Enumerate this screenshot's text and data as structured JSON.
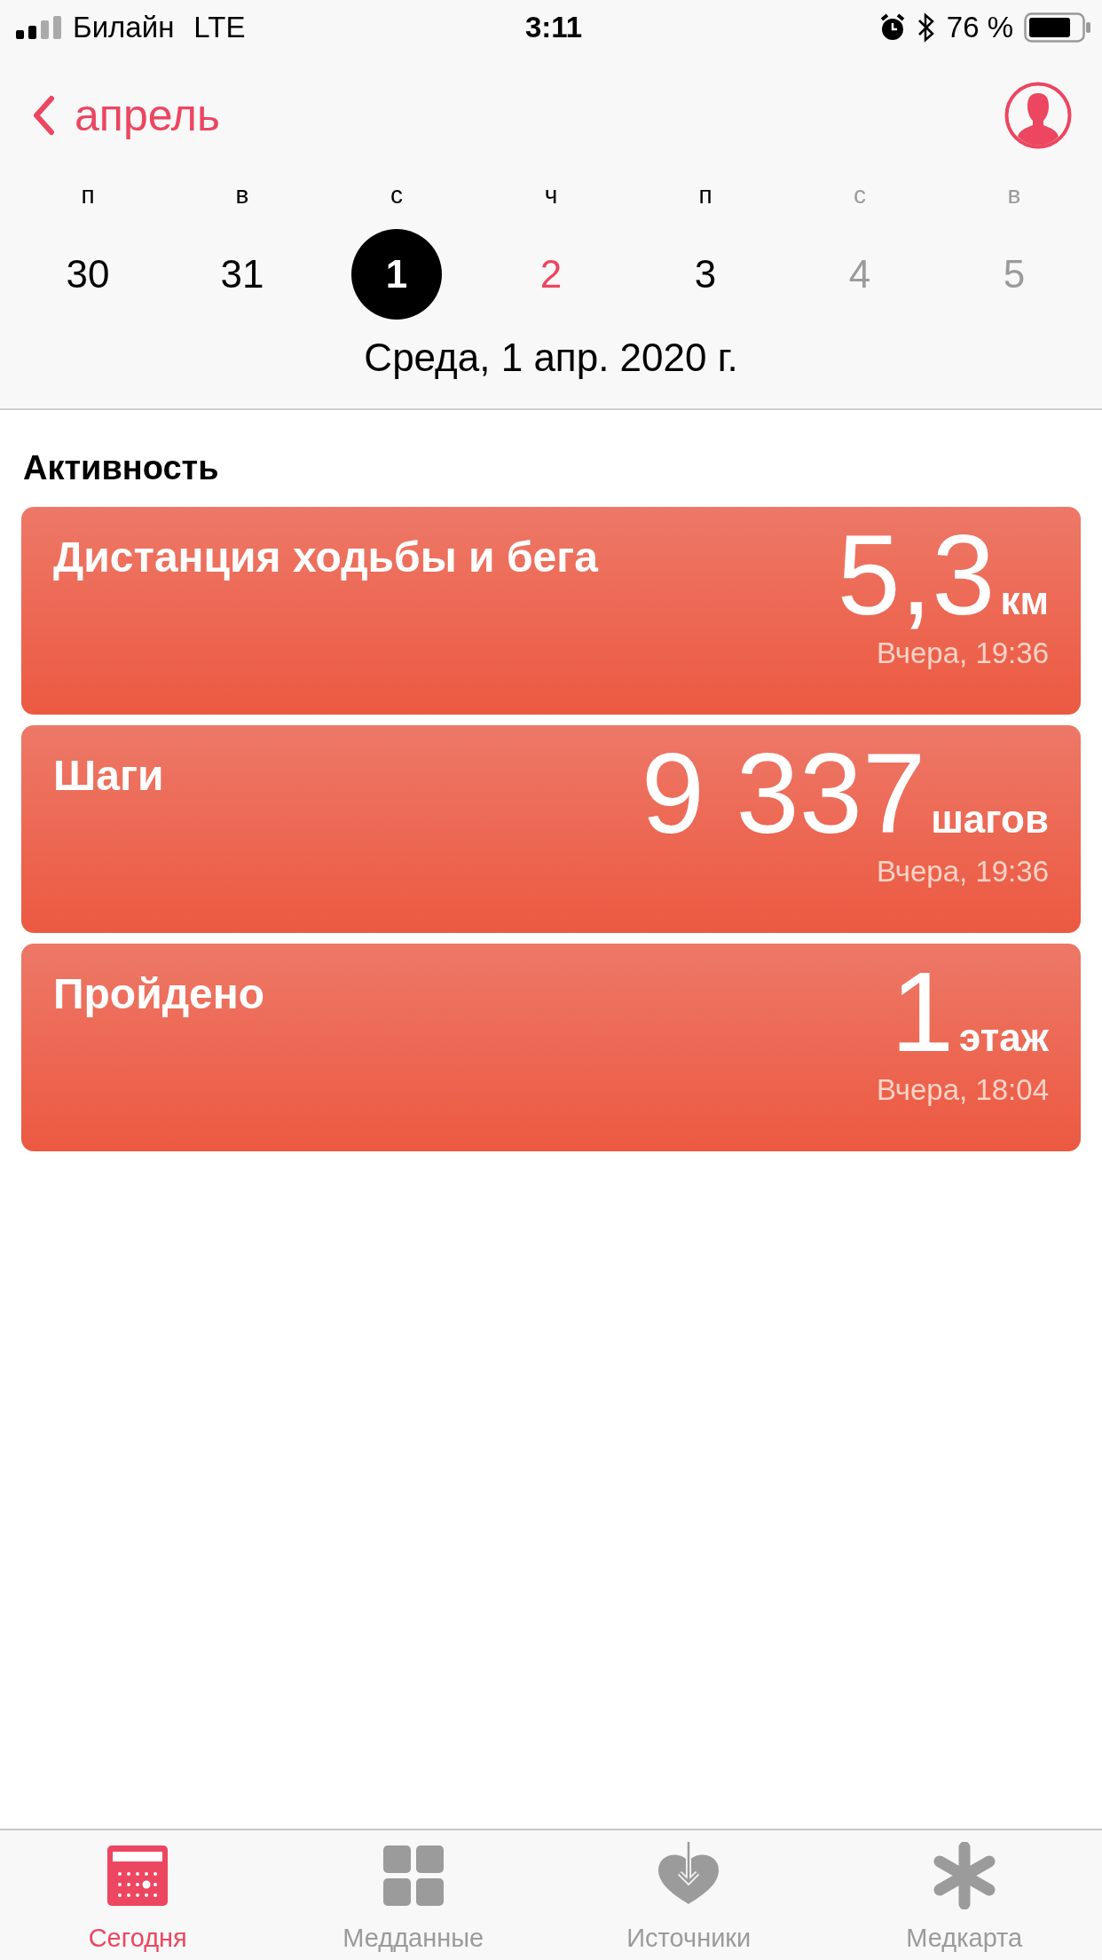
{
  "status_bar": {
    "carrier": "Билайн",
    "network": "LTE",
    "time": "3:11",
    "battery": "76 %"
  },
  "header": {
    "back_label": "апрель"
  },
  "week": [
    {
      "weekday": "п",
      "day": "30",
      "selected": false,
      "today": false,
      "future": false
    },
    {
      "weekday": "в",
      "day": "31",
      "selected": false,
      "today": false,
      "future": false
    },
    {
      "weekday": "с",
      "day": "1",
      "selected": true,
      "today": false,
      "future": false
    },
    {
      "weekday": "ч",
      "day": "2",
      "selected": false,
      "today": true,
      "future": false
    },
    {
      "weekday": "п",
      "day": "3",
      "selected": false,
      "today": false,
      "future": false
    },
    {
      "weekday": "с",
      "day": "4",
      "selected": false,
      "today": false,
      "future": true
    },
    {
      "weekday": "в",
      "day": "5",
      "selected": false,
      "today": false,
      "future": true
    }
  ],
  "selected_date": "Среда, 1 апр. 2020 г.",
  "section_title": "Активность",
  "cards": [
    {
      "title": "Дистанция ходьбы и бега",
      "value": "5,3",
      "unit": "км",
      "time": "Вчера, 19:36"
    },
    {
      "title": "Шаги",
      "value": "9 337",
      "unit": "шагов",
      "time": "Вчера, 19:36"
    },
    {
      "title": "Пройдено",
      "value": "1",
      "unit": "этаж",
      "time": "Вчера, 18:04"
    }
  ],
  "tabs": [
    {
      "kind": "today",
      "label": "Сегодня",
      "selected": true
    },
    {
      "kind": "data",
      "label": "Медданные",
      "selected": false
    },
    {
      "kind": "sources",
      "label": "Источники",
      "selected": false
    },
    {
      "kind": "medid",
      "label": "Медкарта",
      "selected": false
    }
  ]
}
